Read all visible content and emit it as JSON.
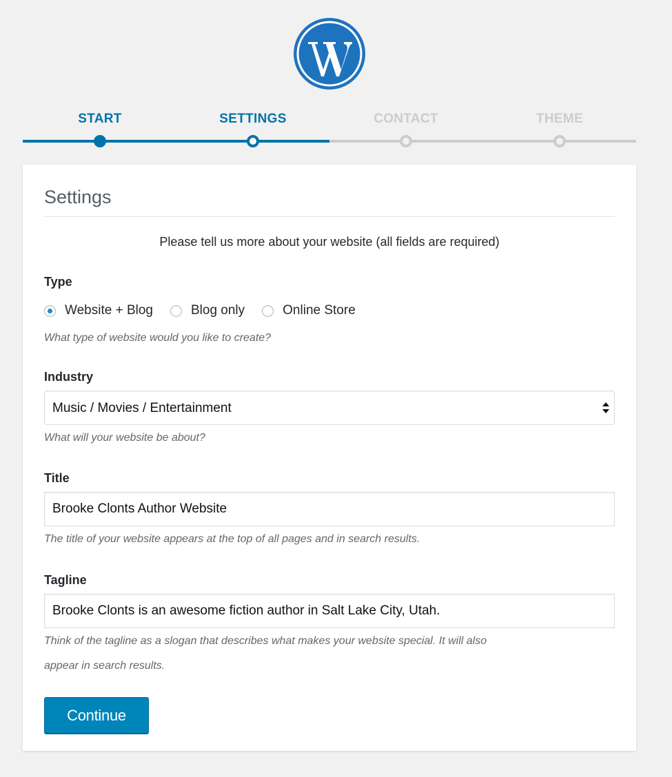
{
  "colors": {
    "accent": "#0073aa",
    "inactive": "#cccccc",
    "button": "#0085ba",
    "background": "#f1f1f1"
  },
  "logo": {
    "icon": "wordpress-logo-icon"
  },
  "steps": [
    {
      "label": "START",
      "state": "complete"
    },
    {
      "label": "SETTINGS",
      "state": "current"
    },
    {
      "label": "CONTACT",
      "state": "pending"
    },
    {
      "label": "THEME",
      "state": "pending"
    }
  ],
  "card": {
    "title": "Settings",
    "intro": "Please tell us more about your website (all fields are required)"
  },
  "type_field": {
    "label": "Type",
    "options": [
      {
        "label": "Website + Blog",
        "checked": true
      },
      {
        "label": "Blog only",
        "checked": false
      },
      {
        "label": "Online Store",
        "checked": false
      }
    ],
    "hint": "What type of website would you like to create?"
  },
  "industry_field": {
    "label": "Industry",
    "selected": "Music / Movies / Entertainment",
    "hint": "What will your website be about?"
  },
  "title_field": {
    "label": "Title",
    "value": "Brooke Clonts Author Website",
    "hint": "The title of your website appears at the top of all pages and in search results."
  },
  "tagline_field": {
    "label": "Tagline",
    "value": "Brooke Clonts is an awesome fiction author in Salt Lake City, Utah.",
    "hint_line1": "Think of the tagline as a slogan that describes what makes your website special. It will also",
    "hint_line2": "appear in search results."
  },
  "actions": {
    "continue_label": "Continue"
  }
}
